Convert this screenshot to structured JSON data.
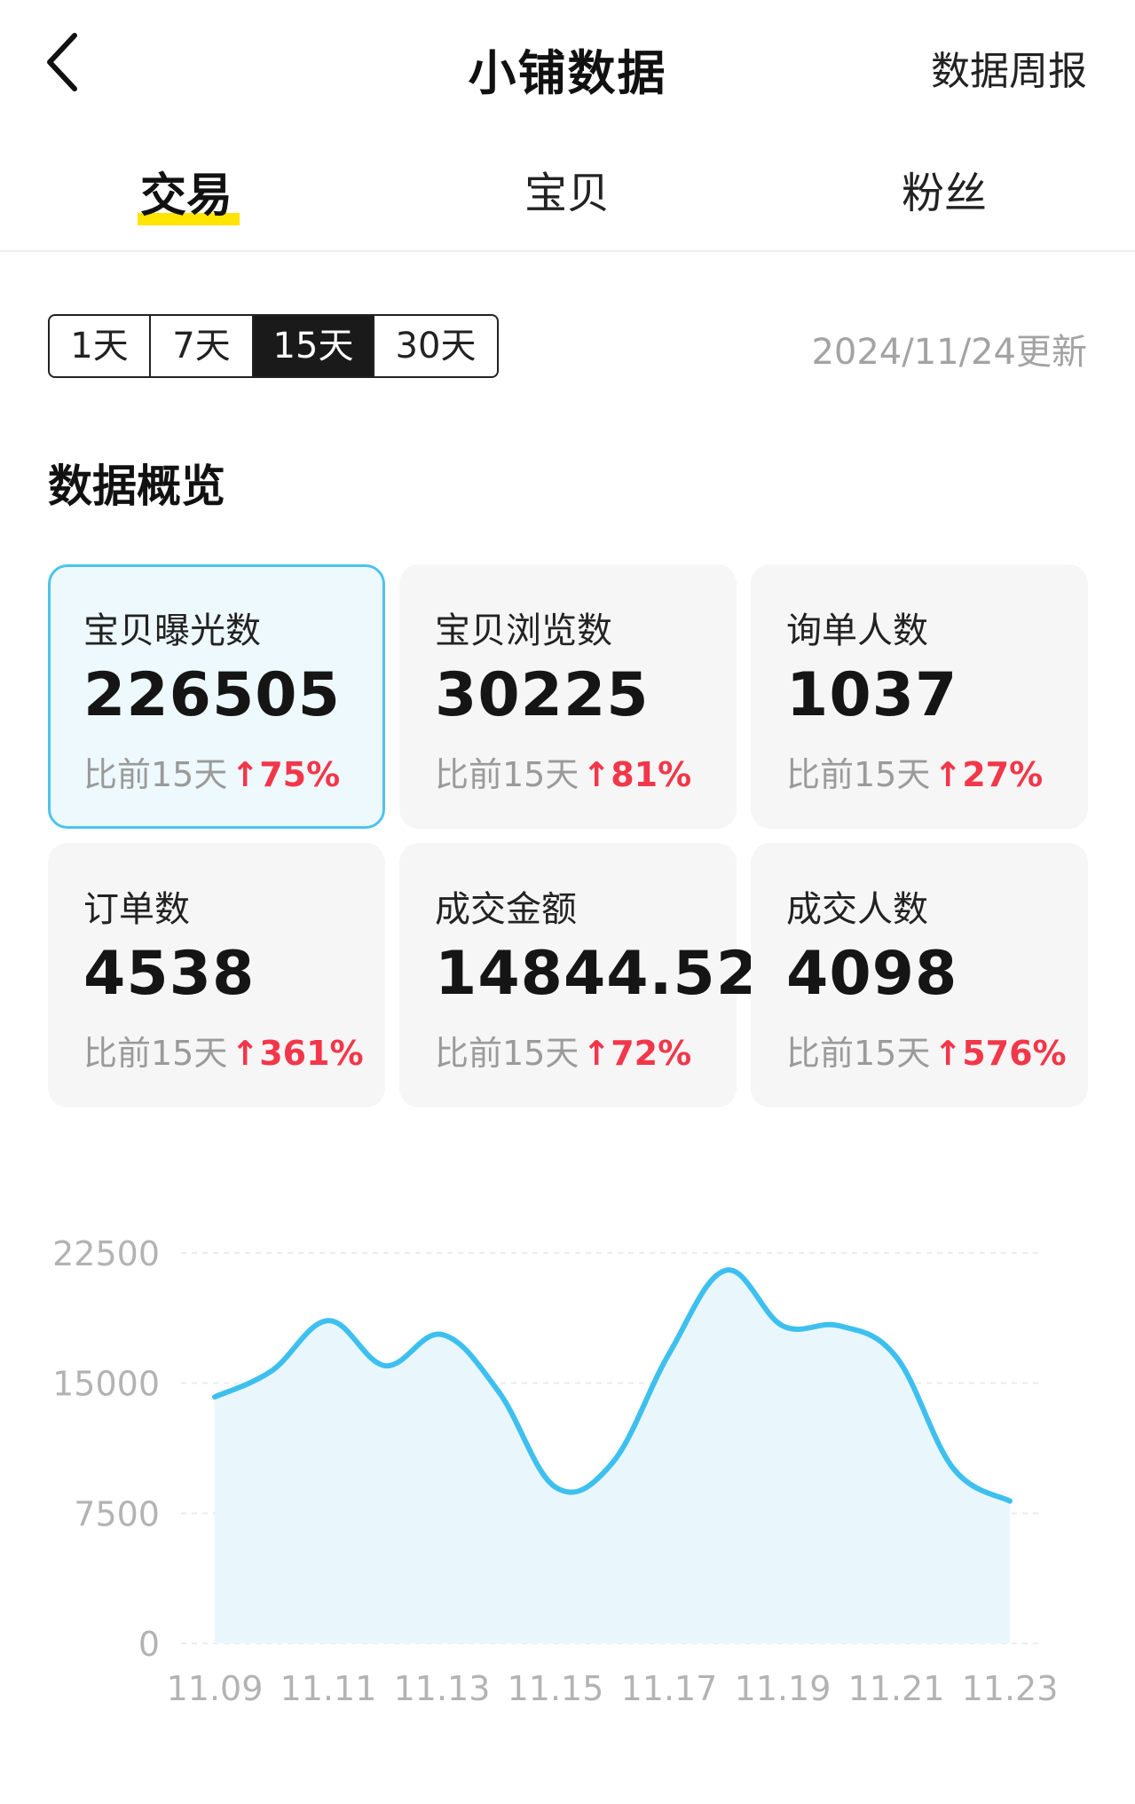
{
  "header": {
    "title": "小铺数据",
    "weekly_report": "数据周报",
    "back_icon": "chevron-left-icon"
  },
  "tabs": [
    {
      "label": "交易",
      "active": true
    },
    {
      "label": "宝贝",
      "active": false
    },
    {
      "label": "粉丝",
      "active": false
    }
  ],
  "period": {
    "options": [
      "1天",
      "7天",
      "15天",
      "30天"
    ],
    "selected": "15天"
  },
  "update_time": "2024/11/24更新",
  "overview": {
    "title": "数据概览",
    "cards": [
      {
        "label": "宝贝曝光数",
        "value": "226505",
        "compare": "比前15天",
        "change": "75%",
        "selected": true
      },
      {
        "label": "宝贝浏览数",
        "value": "30225",
        "compare": "比前15天",
        "change": "81%",
        "selected": false
      },
      {
        "label": "询单人数",
        "value": "1037",
        "compare": "比前15天",
        "change": "27%",
        "selected": false
      },
      {
        "label": "订单数",
        "value": "4538",
        "compare": "比前15天",
        "change": "361%",
        "selected": false
      },
      {
        "label": "成交金额",
        "value": "14844.52",
        "compare": "比前15天",
        "change": "72%",
        "selected": false
      },
      {
        "label": "成交人数",
        "value": "4098",
        "compare": "比前15天",
        "change": "576%",
        "selected": false
      }
    ],
    "up_color": "#f2374a",
    "selected_border_color": "#4dc3ee"
  },
  "chart_data": {
    "type": "area",
    "x": [
      "11.09",
      "11.10",
      "11.11",
      "11.12",
      "11.13",
      "11.14",
      "11.15",
      "11.16",
      "11.17",
      "11.18",
      "11.19",
      "11.20",
      "11.21",
      "11.22",
      "11.23"
    ],
    "x_tick_labels": [
      "11.09",
      "11.11",
      "11.13",
      "11.15",
      "11.17",
      "11.19",
      "11.21",
      "11.23"
    ],
    "values": [
      14200,
      15700,
      18600,
      16000,
      17800,
      14500,
      9000,
      10400,
      16700,
      21500,
      18300,
      18300,
      16500,
      10100,
      8200
    ],
    "y_ticks": [
      "22500",
      "15000",
      "7500",
      "0"
    ],
    "ylim": [
      0,
      22500
    ],
    "grid": true,
    "line_color": "#3ec0ef",
    "fill_color": "#e9f7fd"
  }
}
